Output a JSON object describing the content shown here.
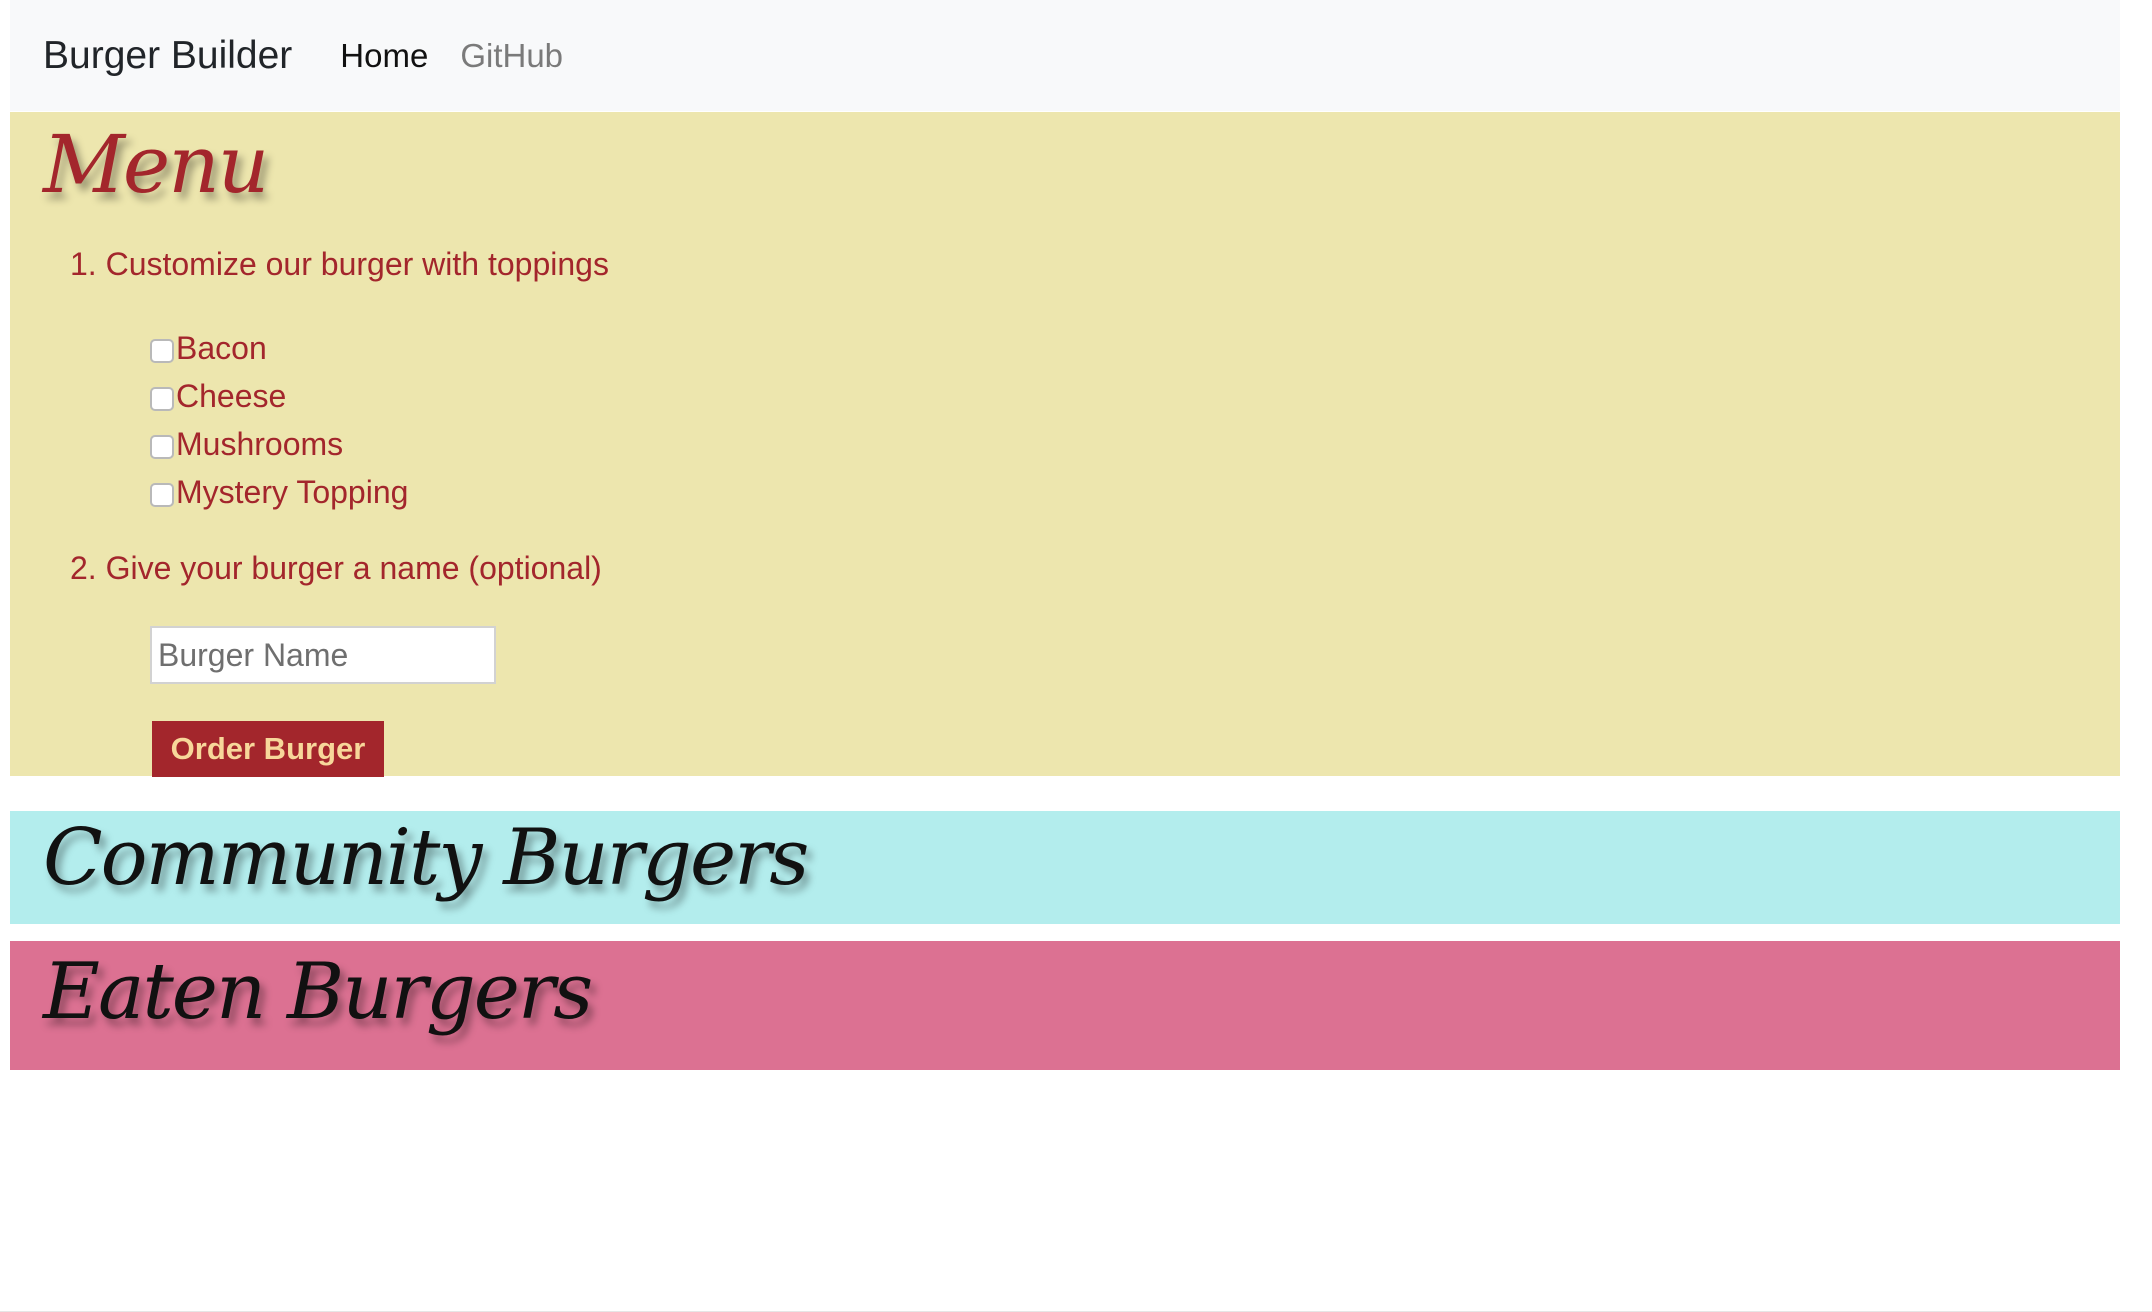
{
  "navbar": {
    "brand": "Burger Builder",
    "links": [
      {
        "label": "Home",
        "active": true
      },
      {
        "label": "GitHub",
        "active": false
      }
    ]
  },
  "menu": {
    "title": "Menu",
    "step1": "1. Customize our burger with toppings",
    "toppings": [
      {
        "label": "Bacon",
        "checked": false
      },
      {
        "label": "Cheese",
        "checked": false
      },
      {
        "label": "Mushrooms",
        "checked": false
      },
      {
        "label": "Mystery Topping",
        "checked": false
      }
    ],
    "step2": "2. Give your burger a name (optional)",
    "name_input": {
      "value": "",
      "placeholder": "Burger Name"
    },
    "order_button": "Order Burger"
  },
  "community": {
    "title": "Community Burgers"
  },
  "eaten": {
    "title": "Eaten Burgers"
  },
  "colors": {
    "menu_bg": "#ede6ae",
    "menu_text": "#a3262c",
    "button_bg": "#a3262c",
    "button_text": "#f7d79a",
    "community_bg": "#b3eded",
    "eaten_bg": "#dc7192",
    "navbar_bg": "#f8f9fa"
  }
}
